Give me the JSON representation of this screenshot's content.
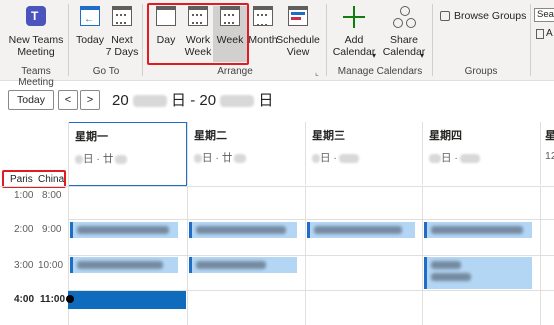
{
  "ribbon": {
    "new_teams_meeting": "New Teams\nMeeting",
    "today": "Today",
    "next7": "Next\n7 Days",
    "day": "Day",
    "work_week": "Work\nWeek",
    "week": "Week",
    "month": "Month",
    "schedule_view": "Schedule\nView",
    "add_calendar": "Add\nCalendar",
    "share_calendar": "Share\nCalendar",
    "browse_groups": "Browse Groups",
    "search_partial": "Searc",
    "a_partial": "A",
    "groups": {
      "teams_meeting": "Teams Meeting",
      "go_to": "Go To",
      "arrange": "Arrange",
      "manage": "Manage Calendars",
      "groups": "Groups"
    }
  },
  "nav": {
    "today_label": "Today",
    "prev": "<",
    "next": ">",
    "range_start": "20",
    "range_mid": "日 - 20",
    "range_end": "日"
  },
  "calendar": {
    "timezones": [
      "Paris",
      "China"
    ],
    "days": [
      {
        "name": "星期一",
        "date_suffix": "日 · 廿"
      },
      {
        "name": "星期二",
        "date_suffix": "日 · 廿"
      },
      {
        "name": "星期三",
        "date_suffix": "日 ·"
      },
      {
        "name": "星期四",
        "date_suffix": "日 ·"
      },
      {
        "name": "星",
        "date_suffix": "12"
      }
    ],
    "times": [
      {
        "paris": "1:00",
        "china": "8:00"
      },
      {
        "paris": "2:00",
        "china": "9:00"
      },
      {
        "paris": "3:00",
        "china": "10:00"
      },
      {
        "paris": "4:00",
        "china": "11:00"
      }
    ]
  },
  "colors": {
    "accent": "#1e6ec8",
    "event_fill": "#b4d6f5",
    "highlight_box": "#e11b22"
  }
}
